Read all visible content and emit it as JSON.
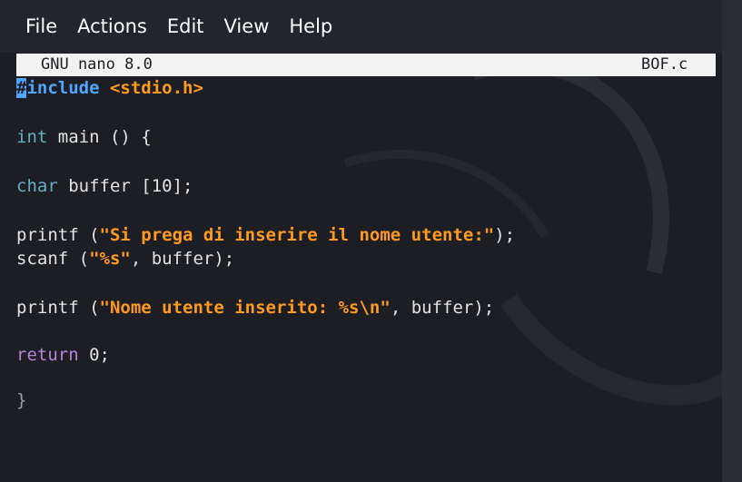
{
  "menu": {
    "items": [
      "File",
      "Actions",
      "Edit",
      "View",
      "Help"
    ]
  },
  "nano": {
    "title": "GNU nano 8.0",
    "filename": "BOF.c"
  },
  "code": {
    "l1_cursor": "#",
    "l1_directive": "include",
    "l1_header": " <stdio.h>",
    "l2_type": "int",
    "l2_rest": " main () {",
    "l3_type": "char",
    "l3_rest": " buffer [10];",
    "l4_fn": "printf (",
    "l4_str": "\"Si prega di inserire il nome utente:\"",
    "l4_end": ");",
    "l5_fn": "scanf (",
    "l5_str": "\"%s\"",
    "l5_end": ", buffer);",
    "l6_fn": "printf (",
    "l6_str": "\"Nome utente inserito: %s\\n\"",
    "l6_end": ", buffer);",
    "l7_kw": "return",
    "l7_rest": " 0;",
    "l8": "}"
  },
  "colors": {
    "directive": "#4ea6ff",
    "string": "#ff9a1f",
    "type": "#5fb1c3",
    "return": "#b784d9",
    "background": "#1c1e24"
  }
}
